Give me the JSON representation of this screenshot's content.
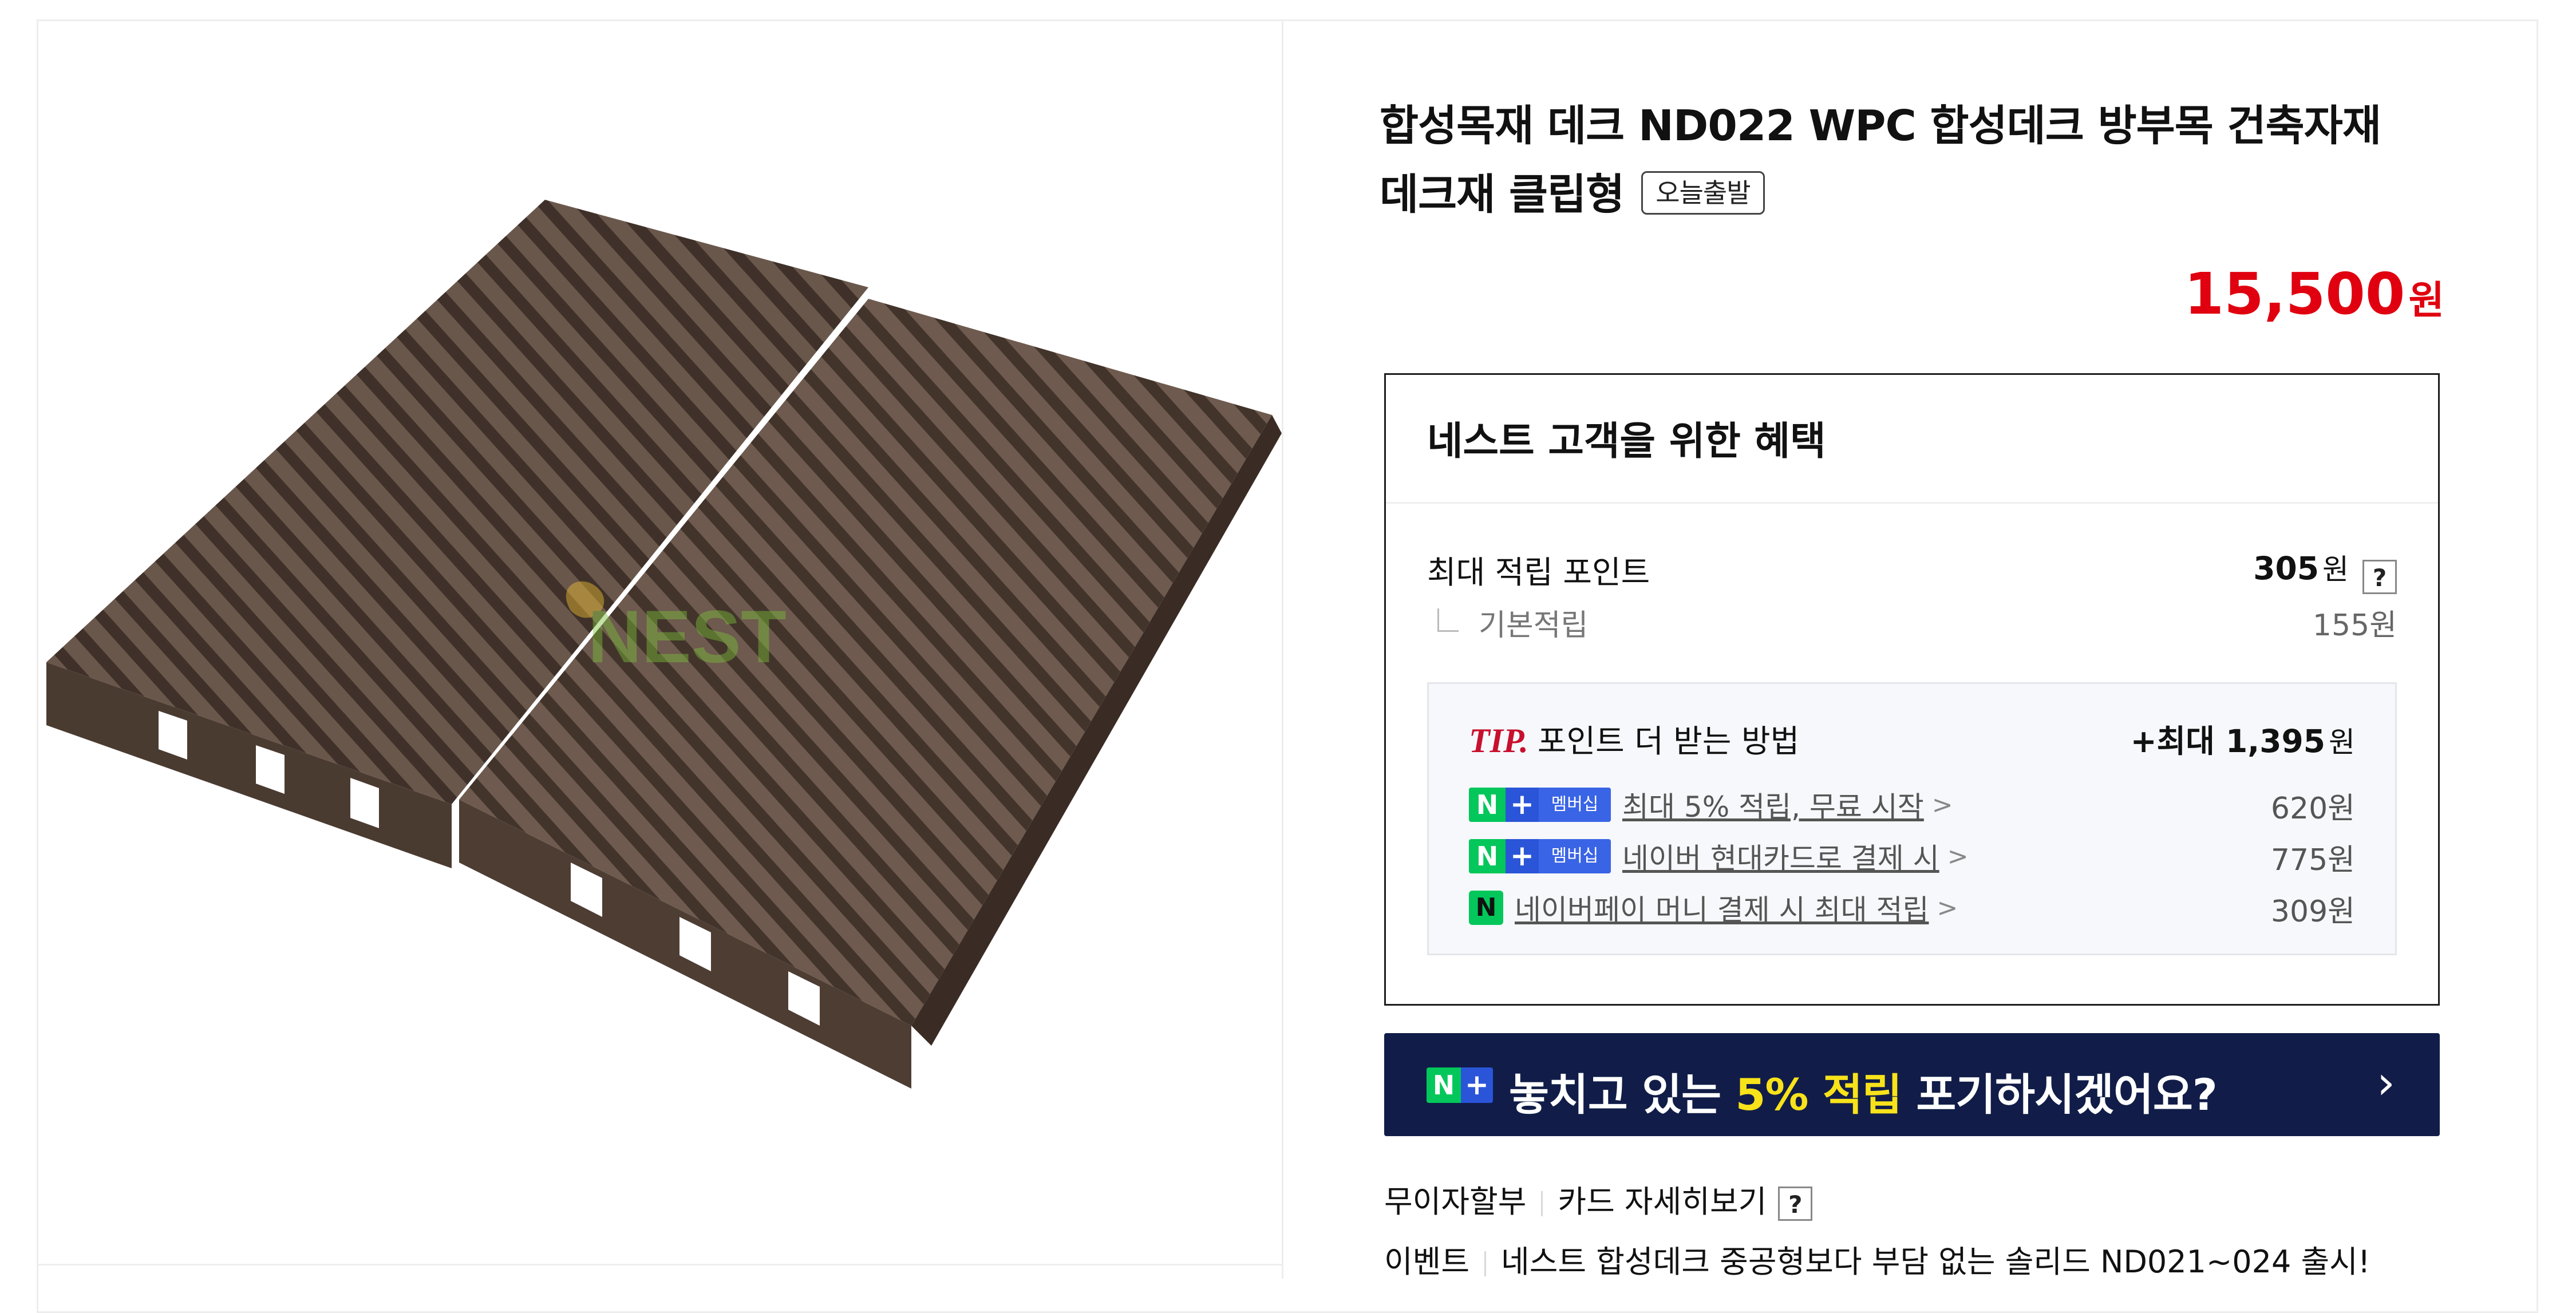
{
  "product": {
    "title": "합성목재 데크 ND022 WPC 합성데크 방부목 건축자재 데크재 클립형",
    "badge": "오늘출발",
    "price": "15,500",
    "currency": "원",
    "image_watermark": "NEST"
  },
  "benefits": {
    "heading": "네스트 고객을 위한 혜택",
    "max_points_label": "최대 적립 포인트",
    "max_points_value": "305",
    "max_points_unit": "원",
    "help_label": "?",
    "base_label": "기본적립",
    "base_value": "155원",
    "tip": {
      "tip_label": "TIP.",
      "title": "포인트 더 받는 방법",
      "max_prefix": "+최대 1,395",
      "max_unit": "원",
      "items": [
        {
          "badge_n": "N",
          "badge_plus": "+",
          "badge_text": "멤버십",
          "label": "최대 5% 적립, 무료 시작",
          "amount": "620원",
          "icon": "naver-plus-membership-icon"
        },
        {
          "badge_n": "N",
          "badge_plus": "+",
          "badge_text": "멤버십",
          "label": "네이버 현대카드로 결제 시",
          "amount": "775원",
          "icon": "naver-plus-membership-icon"
        },
        {
          "badge_n": "N",
          "label": "네이버페이 머니 결제 시 최대 적립",
          "amount": "309원",
          "icon": "naver-pay-icon"
        }
      ]
    }
  },
  "banner": {
    "badge_n": "N",
    "badge_plus": "+",
    "text_before": "놓치고 있는",
    "text_highlight": "5% 적립",
    "text_after": "포기하시겠어요?",
    "chevron": "›"
  },
  "meta": {
    "installment_label": "무이자할부",
    "card_detail_label": "카드 자세히보기",
    "help_label": "?",
    "event_label": "이벤트",
    "event_text": "네스트 합성데크 중공형보다 부담 없는 솔리드 ND021~024 출시!"
  },
  "colors": {
    "price": "#e0000f",
    "banner_bg": "#111d48",
    "banner_highlight": "#f8e21a",
    "naver_green": "#03c75a",
    "naver_blue": "#2b55d9",
    "tip_red": "#c8102e",
    "deck_brown": "#5b4a40"
  }
}
